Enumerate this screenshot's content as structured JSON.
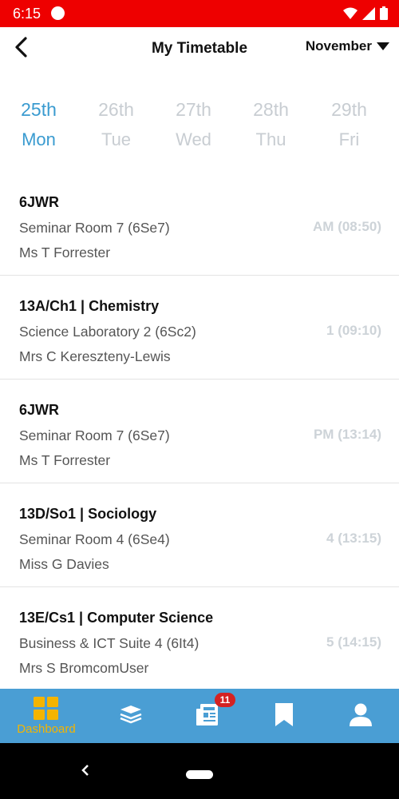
{
  "status_bar": {
    "time": "6:15",
    "icons": [
      "dot-icon",
      "wifi-icon",
      "signal-icon",
      "battery-icon"
    ]
  },
  "header": {
    "title": "My Timetable",
    "month": "November"
  },
  "days": [
    {
      "date": "25th",
      "name": "Mon",
      "active": true
    },
    {
      "date": "26th",
      "name": "Tue",
      "active": false
    },
    {
      "date": "27th",
      "name": "Wed",
      "active": false
    },
    {
      "date": "28th",
      "name": "Thu",
      "active": false
    },
    {
      "date": "29th",
      "name": "Fri",
      "active": false
    }
  ],
  "lessons": [
    {
      "title": "6JWR",
      "room": "Seminar Room 7 (6Se7)",
      "teacher": "Ms T Forrester",
      "period": "AM (08:50)"
    },
    {
      "title": "13A/Ch1  |  Chemistry",
      "room": "Science Laboratory 2 (6Sc2)",
      "teacher": "Mrs C Kereszteny-Lewis",
      "period": "1 (09:10)"
    },
    {
      "title": "6JWR",
      "room": "Seminar Room 7 (6Se7)",
      "teacher": "Ms T Forrester",
      "period": "PM (13:14)"
    },
    {
      "title": "13D/So1  |  Sociology",
      "room": "Seminar Room 4 (6Se4)",
      "teacher": "Miss G Davies",
      "period": "4 (13:15)"
    },
    {
      "title": "13E/Cs1  |  Computer Science",
      "room": "Business & ICT Suite 4 (6It4)",
      "teacher": "Mrs S BromcomUser",
      "period": "5 (14:15)"
    }
  ],
  "bottom_nav": {
    "items": [
      {
        "label": "Dashboard",
        "icon": "dashboard-icon",
        "active": true
      },
      {
        "label": "",
        "icon": "books-icon"
      },
      {
        "label": "",
        "icon": "news-icon",
        "badge": "11"
      },
      {
        "label": "",
        "icon": "bookmark-icon"
      },
      {
        "label": "",
        "icon": "profile-icon"
      }
    ]
  },
  "colors": {
    "status_bar": "#ee0000",
    "accent": "#3a9bd0",
    "nav_bg": "#4a9ed4",
    "nav_active": "#f4b400",
    "badge": "#d42222"
  }
}
